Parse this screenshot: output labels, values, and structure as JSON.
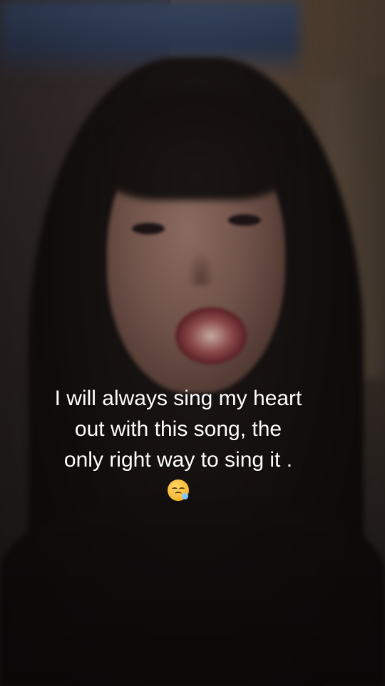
{
  "caption": {
    "lines": [
      "I will always sing my heart",
      "out with this song, the",
      "only right way to sing it ."
    ],
    "emoji": "sleepy-face-emoji"
  }
}
